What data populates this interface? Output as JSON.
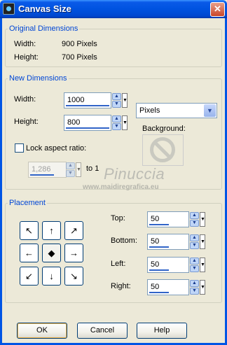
{
  "window": {
    "title": "Canvas Size",
    "close_glyph": "✕"
  },
  "original": {
    "legend": "Original Dimensions",
    "width_label": "Width:",
    "width_value": "900 Pixels",
    "height_label": "Height:",
    "height_value": "700 Pixels"
  },
  "new_dims": {
    "legend": "New Dimensions",
    "width_label": "Width:",
    "width_value": "1000",
    "height_label": "Height:",
    "height_value": "800",
    "units": "Pixels",
    "lock_label": "Lock aspect ratio:",
    "lock_checked": false,
    "ratio_value": "1,286",
    "to_one": "to 1",
    "background_label": "Background:"
  },
  "watermark": {
    "text": "Pinuccia",
    "url": "www.maidiregrafica.eu"
  },
  "placement": {
    "legend": "Placement",
    "grid": [
      {
        "glyph": "↖",
        "icon": "arrow-up-left-icon"
      },
      {
        "glyph": "↑",
        "icon": "arrow-up-icon"
      },
      {
        "glyph": "↗",
        "icon": "arrow-up-right-icon"
      },
      {
        "glyph": "←",
        "icon": "arrow-left-icon"
      },
      {
        "glyph": "◆",
        "icon": "center-diamond-icon"
      },
      {
        "glyph": "→",
        "icon": "arrow-right-icon"
      },
      {
        "glyph": "↙",
        "icon": "arrow-down-left-icon"
      },
      {
        "glyph": "↓",
        "icon": "arrow-down-icon"
      },
      {
        "glyph": "↘",
        "icon": "arrow-down-right-icon"
      }
    ],
    "selected": "center",
    "top_label": "Top:",
    "top_value": "50",
    "bottom_label": "Bottom:",
    "bottom_value": "50",
    "left_label": "Left:",
    "left_value": "50",
    "right_label": "Right:",
    "right_value": "50"
  },
  "buttons": {
    "ok": "OK",
    "cancel": "Cancel",
    "help": "Help"
  },
  "glyphs": {
    "up": "▲",
    "down": "▼",
    "drop": "▼"
  }
}
